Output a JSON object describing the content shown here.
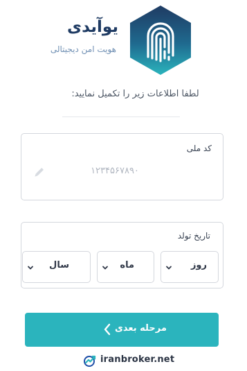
{
  "brand": {
    "name": "یوآیدی",
    "tagline": "هویت امن دیجیتالی",
    "colors": {
      "logo_top": "#1f3b63",
      "logo_bottom": "#2bb4bd"
    },
    "logo_icon": "fingerprint-icon"
  },
  "instruction": "لطفا اطلاعات زیر را تکمیل نمایید:",
  "national_code": {
    "label": "کد ملی",
    "value": "۱۲۳۴۵۶۷۸۹۰",
    "edit_icon": "pencil-icon"
  },
  "birth_date": {
    "label": "تاریخ تولد",
    "day": "روز",
    "month": "ماه",
    "year": "سال"
  },
  "next_button": {
    "label": "مرحله بعدی",
    "color": "#2bb4bd"
  },
  "footer": {
    "brand": "iranbroker.net",
    "icon": "trend-check-icon"
  }
}
